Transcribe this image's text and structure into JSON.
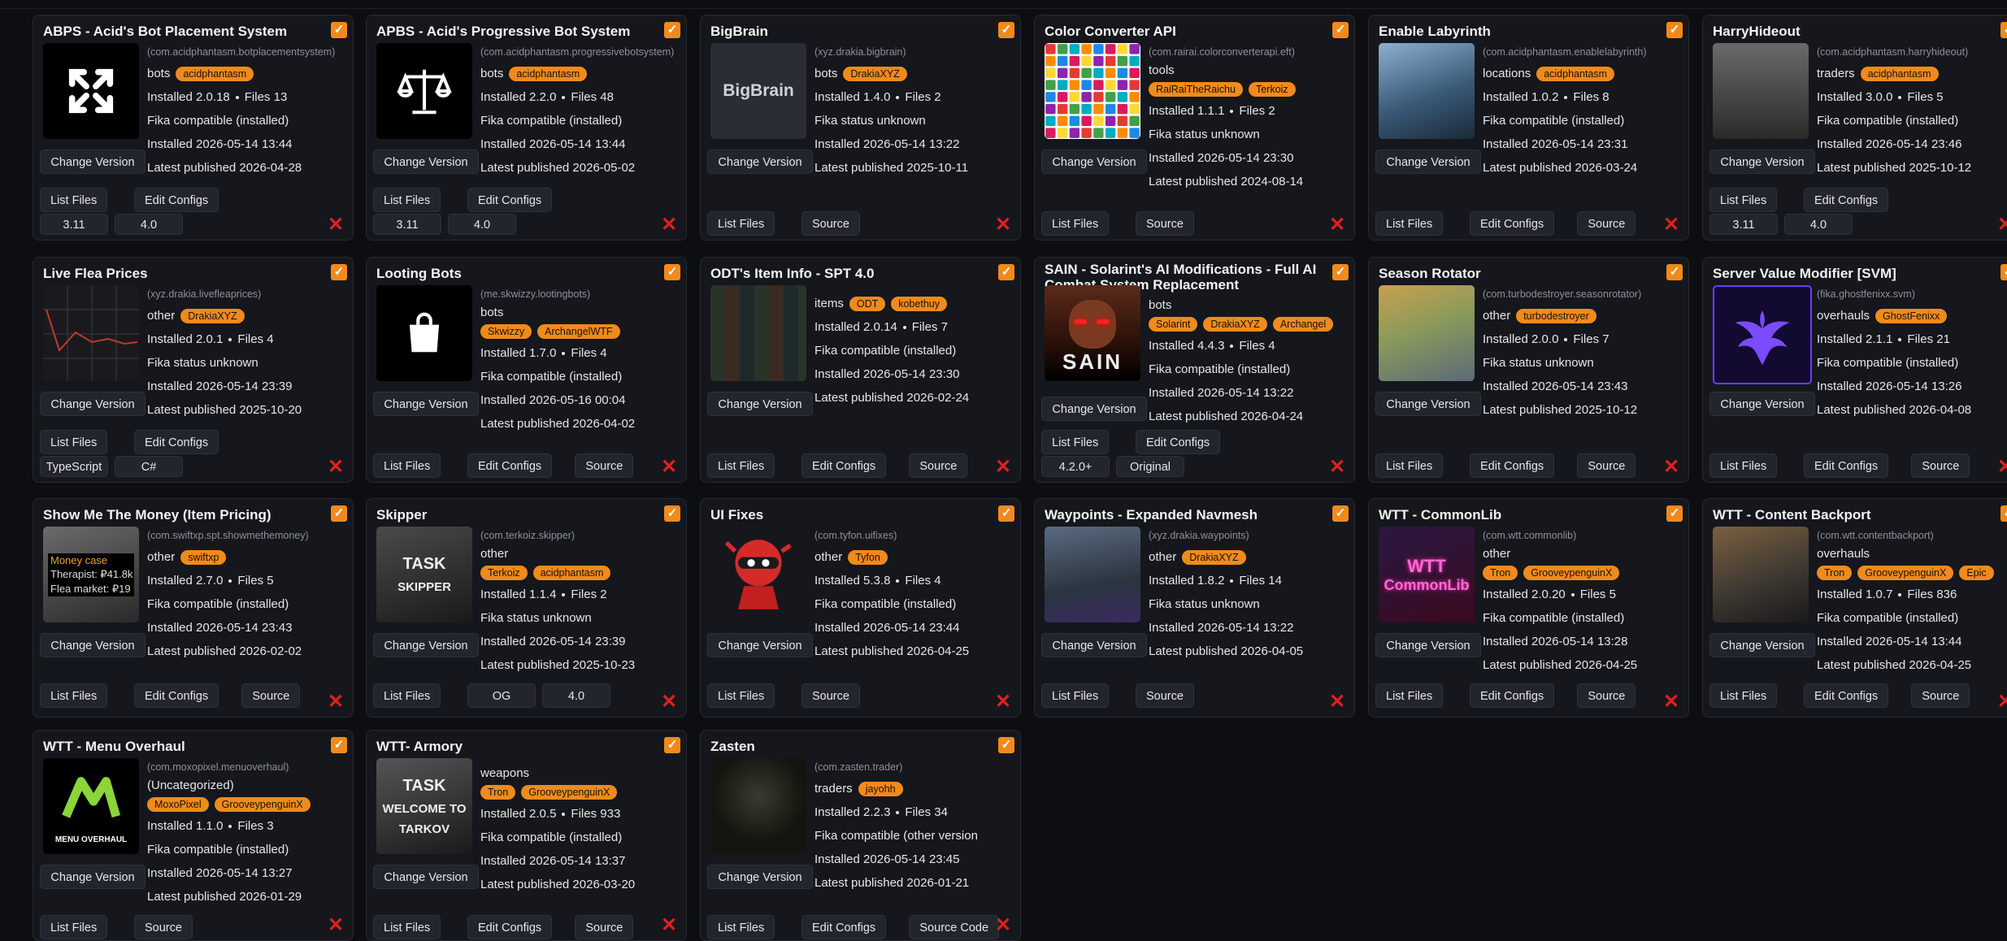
{
  "cards": [
    {
      "title": "ABPS - Acid's Bot Placement System",
      "package": "(com.acidphantasm.botplacementsystem)",
      "category": "bots",
      "authors": [
        "acidphantasm"
      ],
      "installed": "2.0.18",
      "files": "13",
      "status": "Fika compatible (installed)",
      "installed_date": "2026-05-14 13:44",
      "published": "2026-04-28",
      "buttons": [
        "List Files",
        "Edit Configs"
      ],
      "versions": [
        "3.11",
        "4.0"
      ],
      "thumb_icon": "arrows-expand-icon",
      "thumb_bg": "#000000"
    },
    {
      "title": "APBS - Acid's Progressive Bot System",
      "package": "(com.acidphantasm.progressivebotsystem)",
      "category": "bots",
      "authors": [
        "acidphantasm"
      ],
      "installed": "2.2.0",
      "files": "48",
      "status": "Fika compatible (installed)",
      "installed_date": "2026-05-14 13:44",
      "published": "2026-05-02",
      "buttons": [
        "List Files",
        "Edit Configs"
      ],
      "versions": [
        "3.11",
        "4.0"
      ],
      "thumb_icon": "scales-icon",
      "thumb_bg": "#000000"
    },
    {
      "title": "BigBrain",
      "package": "(xyz.drakia.bigbrain)",
      "category": "bots",
      "authors": [
        "DrakiaXYZ"
      ],
      "installed": "1.4.0",
      "files": "2",
      "status": "Fika status unknown",
      "installed_date": "2026-05-14 13:22",
      "published": "2025-10-11",
      "buttons": [
        "List Files",
        "Source"
      ],
      "versions": [],
      "thumb_icon": "bigbrain-logo",
      "thumb_text": "BigBrain",
      "thumb_bg": "#2a2d35"
    },
    {
      "title": "Color Converter API",
      "package": "(com.rairai.colorconverterapi.eft)",
      "category": "tools",
      "authors": [
        "RaiRaiTheRaichu",
        "Terkoiz"
      ],
      "installed": "1.1.1",
      "files": "2",
      "status": "Fika status unknown",
      "installed_date": "2026-05-14 23:30",
      "published": "2024-08-14",
      "buttons": [
        "List Files",
        "Source"
      ],
      "versions": [],
      "thumb_icon": "color-grid-icon",
      "thumb_bg": "#ffffff"
    },
    {
      "title": "Enable Labyrinth",
      "package": "(com.acidphantasm.enablelabyrinth)",
      "category": "locations",
      "authors": [
        "acidphantasm"
      ],
      "installed": "1.0.2",
      "files": "8",
      "status": "Fika compatible (installed)",
      "installed_date": "2026-05-14 23:31",
      "published": "2026-03-24",
      "buttons": [
        "List Files",
        "Edit Configs",
        "Source"
      ],
      "versions": [],
      "thumb_icon": "labyrinth-art",
      "thumb_bg": "#4a6a88"
    },
    {
      "title": "HarryHideout",
      "package": "(com.acidphantasm.harryhideout)",
      "category": "traders",
      "authors": [
        "acidphantasm"
      ],
      "installed": "3.0.0",
      "files": "5",
      "status": "Fika compatible (installed)",
      "installed_date": "2026-05-14 23:46",
      "published": "2025-10-12",
      "buttons": [
        "List Files",
        "Edit Configs"
      ],
      "versions": [
        "3.11",
        "4.0"
      ],
      "thumb_icon": "hideout-art",
      "thumb_bg": "#3a3a3a"
    },
    {
      "title": "Live Flea Prices",
      "package": "(xyz.drakia.livefleaprices)",
      "category": "other",
      "authors": [
        "DrakiaXYZ"
      ],
      "installed": "2.0.1",
      "files": "4",
      "status": "Fika status unknown",
      "installed_date": "2026-05-14 23:39",
      "published": "2025-10-20",
      "buttons": [
        "List Files",
        "Edit Configs"
      ],
      "versions": [
        "TypeScript",
        "C#"
      ],
      "thumb_icon": "price-chart-icon",
      "thumb_bg": "#1a1a1e"
    },
    {
      "title": "Looting Bots",
      "package": "(me.skwizzy.lootingbots)",
      "category": "bots",
      "authors": [
        "Skwizzy",
        "ArchangelWTF"
      ],
      "installed": "1.7.0",
      "files": "4",
      "status": "Fika compatible (installed)",
      "installed_date": "2026-05-16 00:04",
      "published": "2026-04-02",
      "buttons": [
        "List Files",
        "Edit Configs",
        "Source"
      ],
      "versions": [],
      "thumb_icon": "shopping-bag-icon",
      "thumb_bg": "#000000"
    },
    {
      "title": "ODT's Item Info - SPT 4.0",
      "package": "",
      "category": "items",
      "authors": [
        "ODT",
        "kobethuy"
      ],
      "installed": "2.0.14",
      "files": "7",
      "status": "Fika compatible (installed)",
      "installed_date": "2026-05-14 23:30",
      "published": "2026-02-24",
      "buttons": [
        "List Files",
        "Edit Configs",
        "Source"
      ],
      "versions": [],
      "thumb_icon": "inventory-art",
      "thumb_bg": "#2a3328"
    },
    {
      "title": "SAIN - Solarint's AI Modifications - Full AI Combat System Replacement",
      "package": "",
      "category": "bots",
      "authors": [
        "Solarint",
        "DrakiaXYZ",
        "Archangel"
      ],
      "installed": "4.4.3",
      "files": "4",
      "status": "Fika compatible (installed)",
      "installed_date": "2026-05-14 13:22",
      "published": "2026-04-24",
      "buttons": [
        "List Files",
        "Edit Configs"
      ],
      "versions": [
        "4.2.0+",
        "Original"
      ],
      "thumb_icon": "sain-art",
      "thumb_text": "SAIN",
      "thumb_bg": "#3a1810"
    },
    {
      "title": "Season Rotator",
      "package": "(com.turbodestroyer.seasonrotator)",
      "category": "other",
      "authors": [
        "turbodestroyer"
      ],
      "installed": "2.0.0",
      "files": "7",
      "status": "Fika status unknown",
      "installed_date": "2026-05-14 23:43",
      "published": "2025-10-12",
      "buttons": [
        "List Files",
        "Edit Configs",
        "Source"
      ],
      "versions": [],
      "thumb_icon": "season-art",
      "thumb_bg": "#7a8a4a"
    },
    {
      "title": "Server Value Modifier [SVM]",
      "package": "(fika.ghostfenixx.svm)",
      "category": "overhauls",
      "authors": [
        "GhostFenixx"
      ],
      "installed": "2.1.1",
      "files": "21",
      "status": "Fika compatible (installed)",
      "installed_date": "2026-05-14 13:26",
      "published": "2026-04-08",
      "buttons": [
        "List Files",
        "Edit Configs",
        "Source"
      ],
      "versions": [],
      "thumb_icon": "phoenix-icon",
      "thumb_bg": "#120a30"
    },
    {
      "title": "Show Me The Money (Item Pricing)",
      "package": "(com.swiftxp.spt.showmethemoney)",
      "category": "other",
      "authors": [
        "swiftxp"
      ],
      "installed": "2.7.0",
      "files": "5",
      "status": "Fika compatible (installed)",
      "installed_date": "2026-05-14 23:43",
      "published": "2026-02-02",
      "buttons": [
        "List Files",
        "Edit Configs",
        "Source"
      ],
      "versions": [],
      "thumb_icon": "money-tooltip-art",
      "thumb_lines": [
        "Money case",
        "Therapist: ₽41.8k",
        "Flea market: ₽19"
      ],
      "thumb_bg": "#3a3a3a"
    },
    {
      "title": "Skipper",
      "package": "(com.terkoiz.skipper)",
      "category": "other",
      "authors": [
        "Terkoiz",
        "acidphantasm"
      ],
      "installed": "1.1.4",
      "files": "2",
      "status": "Fika status unknown",
      "installed_date": "2026-05-14 23:39",
      "published": "2025-10-23",
      "buttons": [
        "List Files",
        "OG",
        "4.0"
      ],
      "versions": [],
      "thumb_icon": "skipper-art",
      "thumb_lines": [
        "TASK",
        "SKIPPER"
      ],
      "thumb_bg": "#2a2a2a"
    },
    {
      "title": "UI Fixes",
      "package": "(com.tyfon.uifixes)",
      "category": "other",
      "authors": [
        "Tyfon"
      ],
      "installed": "5.3.8",
      "files": "4",
      "status": "Fika compatible (installed)",
      "installed_date": "2026-05-14 23:44",
      "published": "2026-04-25",
      "buttons": [
        "List Files",
        "Source"
      ],
      "versions": [],
      "thumb_icon": "ninja-mascot-icon",
      "thumb_bg": "#15171c"
    },
    {
      "title": "Waypoints - Expanded Navmesh",
      "package": "(xyz.drakia.waypoints)",
      "category": "other",
      "authors": [
        "DrakiaXYZ"
      ],
      "installed": "1.8.2",
      "files": "14",
      "status": "Fika status unknown",
      "installed_date": "2026-05-14 13:22",
      "published": "2026-04-05",
      "buttons": [
        "List Files",
        "Source"
      ],
      "versions": [],
      "thumb_icon": "navmesh-art",
      "thumb_bg": "#2b3540"
    },
    {
      "title": "WTT - CommonLib",
      "package": "(com.wtt.commonlib)",
      "category": "other",
      "authors": [
        "Tron",
        "GrooveypenguinX"
      ],
      "installed": "2.0.20",
      "files": "5",
      "status": "Fika compatible (installed)",
      "installed_date": "2026-05-14 13:28",
      "published": "2026-04-25",
      "buttons": [
        "List Files",
        "Edit Configs",
        "Source"
      ],
      "versions": [],
      "thumb_icon": "commonlib-logo",
      "thumb_lines": [
        "WTT",
        "CommonLib"
      ],
      "thumb_bg": "#1a1030"
    },
    {
      "title": "WTT - Content Backport",
      "package": "(com.wtt.contentbackport)",
      "category": "overhauls",
      "authors": [
        "Tron",
        "GrooveypenguinX",
        "Epic"
      ],
      "installed": "1.0.7",
      "files": "836",
      "status": "Fika compatible (installed)",
      "installed_date": "2026-05-14 13:44",
      "published": "2026-04-25",
      "buttons": [
        "List Files",
        "Edit Configs",
        "Source"
      ],
      "versions": [],
      "thumb_icon": "backport-art",
      "thumb_bg": "#3a3530"
    },
    {
      "title": "WTT - Menu Overhaul",
      "package": "(com.moxopixel.menuoverhaul)",
      "category": "(Uncategorized)",
      "authors": [
        "MoxoPixel",
        "GrooveypenguinX"
      ],
      "installed": "1.1.0",
      "files": "3",
      "status": "Fika compatible (installed)",
      "installed_date": "2026-05-14 13:27",
      "published": "2026-01-29",
      "buttons": [
        "List Files",
        "Source"
      ],
      "versions": [],
      "thumb_icon": "menu-overhaul-logo",
      "thumb_text": "MENU OVERHAUL",
      "thumb_bg": "#000000"
    },
    {
      "title": "WTT- Armory",
      "package": "",
      "category": "weapons",
      "authors": [
        "Tron",
        "GrooveypenguinX"
      ],
      "installed": "2.0.5",
      "files": "933",
      "status": "Fika compatible (installed)",
      "installed_date": "2026-05-14 13:37",
      "published": "2026-03-20",
      "buttons": [
        "List Files",
        "Edit Configs",
        "Source"
      ],
      "versions": [],
      "thumb_icon": "armory-art",
      "thumb_lines": [
        "TASK",
        "WELCOME TO",
        "TARKOV"
      ],
      "thumb_bg": "#2a2a2a"
    },
    {
      "title": "Zasten",
      "package": "(com.zasten.trader)",
      "category": "traders",
      "authors": [
        "jayohh"
      ],
      "installed": "2.2.3",
      "files": "34",
      "status": "Fika compatible (other version",
      "installed_date": "2026-05-14 23:45",
      "published": "2026-01-21",
      "buttons": [
        "List Files",
        "Edit Configs",
        "Source Code"
      ],
      "versions": [],
      "thumb_icon": "trader-portrait-art",
      "thumb_bg": "#151510"
    }
  ],
  "labels": {
    "installed": "Installed",
    "files": "Files",
    "latest_published": "Latest published",
    "change_version": "Change Version",
    "check_mark": "✓",
    "remove_mark": "✕"
  },
  "colors": {
    "accent": "#f08a1c",
    "remove": "#e02020",
    "card_bg": "#15171c",
    "page_bg": "#0d0e12"
  }
}
